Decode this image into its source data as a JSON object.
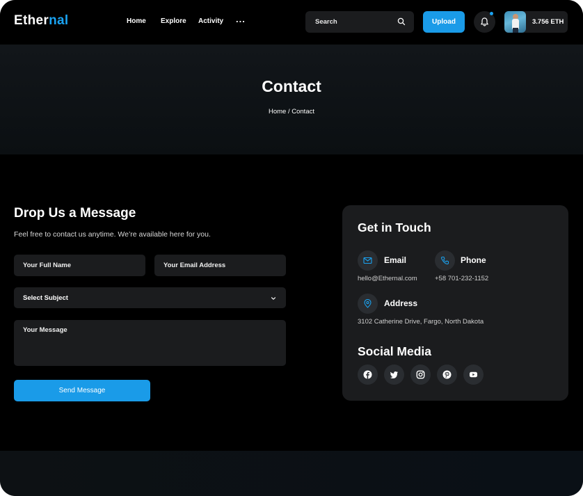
{
  "brand": {
    "part1": "Ether",
    "part2": "nal"
  },
  "nav": {
    "items": [
      "Home",
      "Explore",
      "Activity"
    ],
    "more": "..."
  },
  "search": {
    "placeholder": "Search",
    "icon": "search-icon"
  },
  "header": {
    "upload_label": "Upload",
    "notification_icon": "bell-icon",
    "balance": "3.756 ETH"
  },
  "hero": {
    "title": "Contact",
    "breadcrumb": "Home / Contact"
  },
  "form": {
    "title": "Drop Us a Message",
    "subtitle": "Feel free to contact us anytime. We’re available here for you.",
    "name_placeholder": "Your Full Name",
    "email_placeholder": "Your Email Address",
    "subject_selected": "Select Subject",
    "message_placeholder": "Your Message",
    "submit_label": "Send Message"
  },
  "contact": {
    "title": "Get in Touch",
    "email": {
      "label": "Email",
      "value": "hello@Ethernal.com",
      "icon": "mail-icon"
    },
    "phone": {
      "label": "Phone",
      "value": "+58 701-232-1152",
      "icon": "phone-icon"
    },
    "address": {
      "label": "Address",
      "value": "3102 Catherine Drive, Fargo, North Dakota",
      "icon": "location-pin-icon"
    },
    "social_title": "Social Media",
    "social_icons": [
      "facebook-icon",
      "twitter-icon",
      "instagram-icon",
      "pinterest-icon",
      "youtube-icon"
    ]
  },
  "colors": {
    "accent": "#1a9be8",
    "background": "#000000",
    "card": "#1b1c1e",
    "icon_circle": "#2a2d31"
  }
}
